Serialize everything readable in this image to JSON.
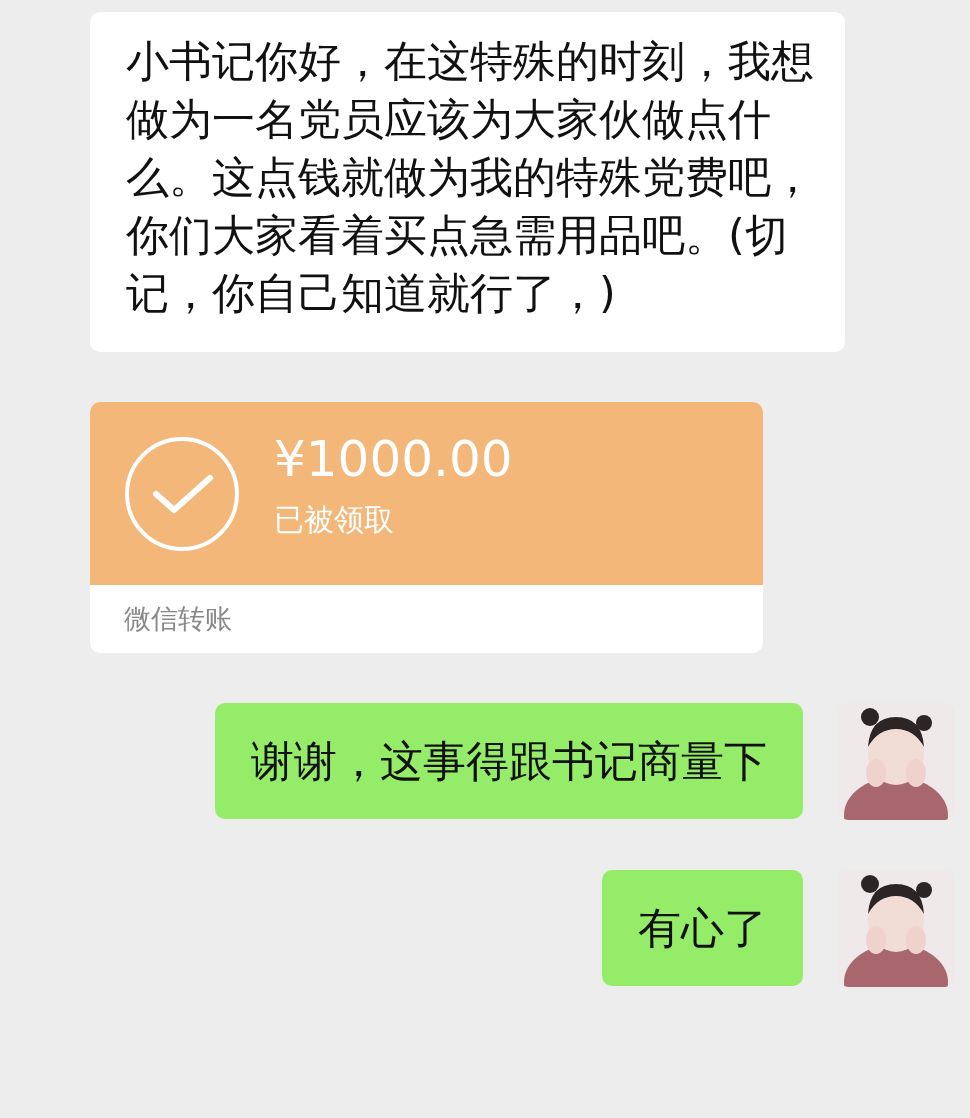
{
  "messages": [
    {
      "kind": "text",
      "from_me": false,
      "text": "小书记你好，在这特殊的时刻，我想做为一名党员应该为大家伙做点什么。这点钱就做为我的特殊党费吧，你们大家看着买点急需用品吧。(切记，你自己知道就行了，)"
    },
    {
      "kind": "transfer",
      "from_me": false,
      "amount": "¥1000.00",
      "status": "已被领取",
      "claimed": true,
      "footer": "微信转账"
    },
    {
      "kind": "text",
      "from_me": true,
      "text": "谢谢，这事得跟书记商量下"
    },
    {
      "kind": "text",
      "from_me": true,
      "text": "有心了"
    }
  ]
}
